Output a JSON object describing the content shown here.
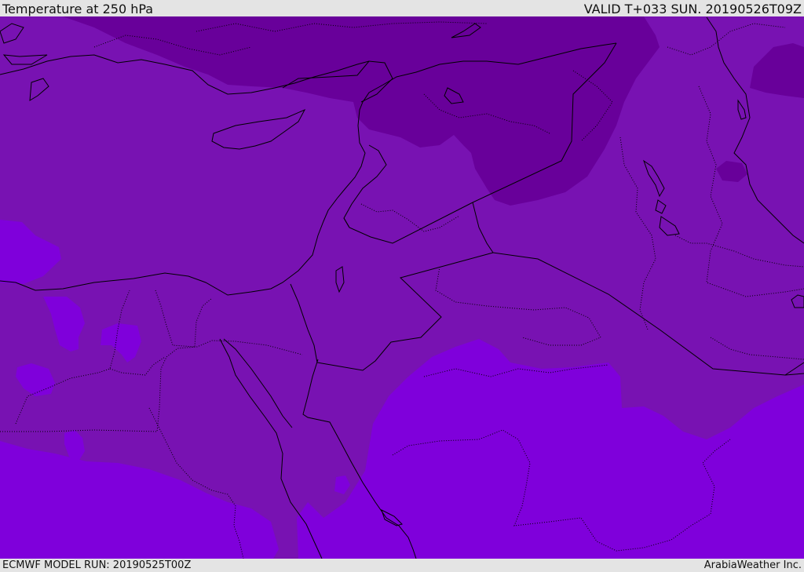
{
  "header": {
    "title": "Temperature at 250 hPa",
    "valid": "VALID T+033 SUN. 20190526T09Z"
  },
  "footer": {
    "model_run": "ECMWF MODEL RUN: 20190525T00Z",
    "credit": "ArabiaWeather Inc."
  },
  "map": {
    "colors": {
      "cold_band": "#68009a",
      "mid_band": "#7812b2",
      "warm_band": "#7f00db",
      "border": "#000000"
    }
  }
}
